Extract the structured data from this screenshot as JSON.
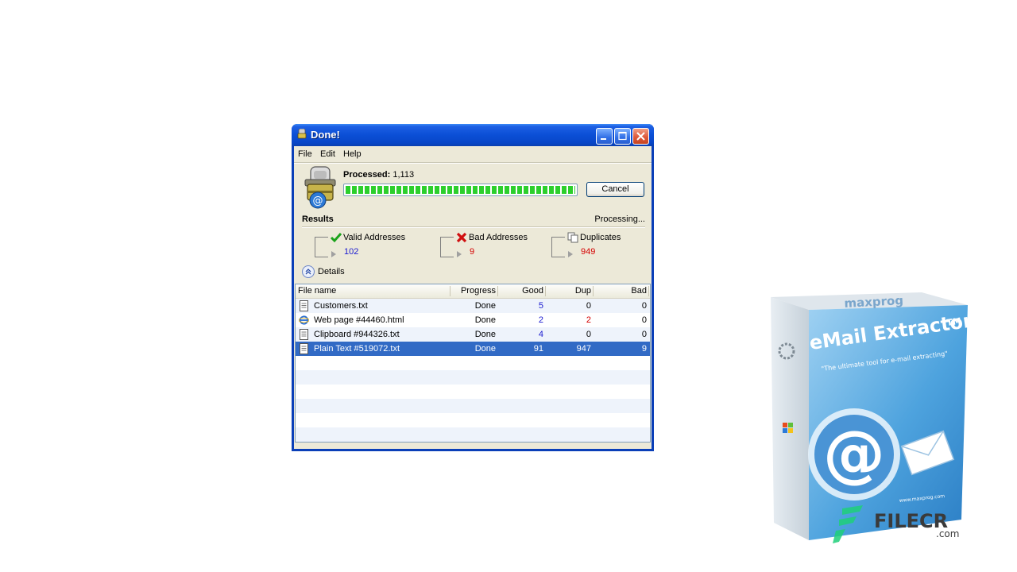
{
  "window": {
    "title": "Done!",
    "menu": [
      "File",
      "Edit",
      "Help"
    ],
    "processed_label": "Processed:",
    "processed_value": "1,113",
    "progress_fraction": 1.0,
    "cancel_label": "Cancel",
    "results_label": "Results",
    "status_text": "Processing...",
    "stats": [
      {
        "label": "Valid Addresses",
        "value": "102",
        "icon": "check-icon",
        "color": "#1a1ad0"
      },
      {
        "label": "Bad Addresses",
        "value": "9",
        "icon": "x-icon",
        "color": "#d40000"
      },
      {
        "label": "Duplicates",
        "value": "949",
        "icon": "duplicates-icon",
        "color": "#d40000"
      }
    ],
    "details_label": "Details",
    "columns": [
      "File name",
      "Progress",
      "Good",
      "Dup",
      "Bad"
    ],
    "rows": [
      {
        "icon": "text-file-icon",
        "name": "Customers.txt",
        "progress": "Done",
        "good": "5",
        "dup": "0",
        "bad": "0"
      },
      {
        "icon": "ie-icon",
        "name": "Web page #44460.html",
        "progress": "Done",
        "good": "2",
        "dup": "2",
        "bad": "0"
      },
      {
        "icon": "text-file-icon",
        "name": "Clipboard #944326.txt",
        "progress": "Done",
        "good": "4",
        "dup": "0",
        "bad": "0"
      },
      {
        "icon": "text-file-icon",
        "name": "Plain Text #519072.txt",
        "progress": "Done",
        "good": "91",
        "dup": "947",
        "bad": "9",
        "selected": true
      }
    ]
  },
  "product_box": {
    "brand": "maxprog",
    "name": "eMail Extractor",
    "trademark": "TM",
    "tagline": "\"The ultimate tool for e-mail extracting\"",
    "url": "www.maxprog.com"
  },
  "watermark": {
    "name": "FILECR",
    "tld": ".com"
  }
}
